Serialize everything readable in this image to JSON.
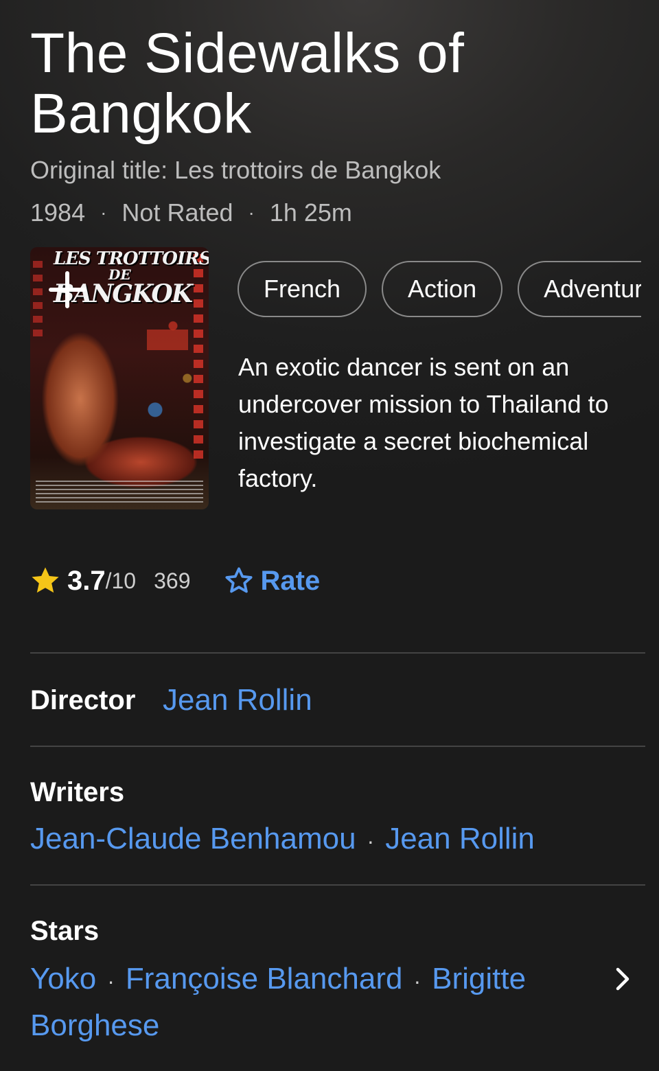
{
  "title": "The Sidewalks of Bangkok",
  "original_title": "Original title: Les trottoirs de Bangkok",
  "meta": {
    "year": "1984",
    "rating": "Not Rated",
    "runtime": "1h 25m",
    "separator": "·"
  },
  "poster": {
    "line1": "LES TROTTOIRS",
    "line2": "DE",
    "line3": "BANGKOK"
  },
  "genres": [
    "French",
    "Action",
    "Adventure"
  ],
  "plot": "An exotic dancer is sent on an undercover mission to Thailand to investigate a secret biochemical factory.",
  "rating": {
    "value": "3.7",
    "max": "/10",
    "count": "369",
    "rate_label": "Rate"
  },
  "director": {
    "label": "Director",
    "names": [
      "Jean Rollin"
    ]
  },
  "writers": {
    "label": "Writers",
    "names": [
      "Jean-Claude Benhamou",
      "Jean Rollin"
    ]
  },
  "stars": {
    "label": "Stars",
    "line1": [
      "Yoko",
      "Françoise Blanchard",
      "Brigitte"
    ],
    "line2": "Borghese"
  },
  "colors": {
    "accent": "#5799ef",
    "star": "#f5c518",
    "background": "#1f1f1f"
  },
  "icons": [
    "add-icon",
    "star-icon",
    "star-outline-icon",
    "chevron-right-icon"
  ]
}
